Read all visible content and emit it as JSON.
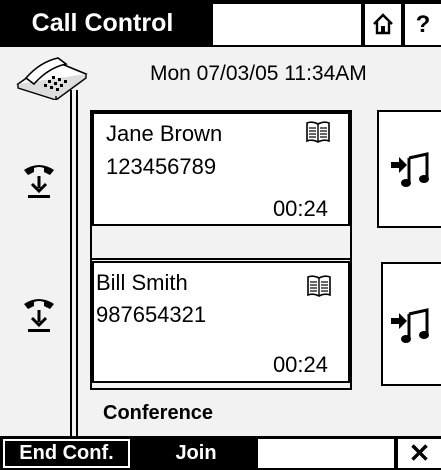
{
  "header": {
    "title": "Call Control",
    "home_icon": "home-icon",
    "help_label": "?"
  },
  "datetime": "Mon 07/03/05 11:34AM",
  "calls": [
    {
      "name": "Jane Brown",
      "number": "123456789",
      "duration": "00:24",
      "icon": "phonebook-icon"
    },
    {
      "name": "Bill Smith",
      "number": "987654321",
      "duration": "00:24",
      "icon": "phonebook-icon"
    }
  ],
  "conference_label": "Conference",
  "softkeys": {
    "end_conf": "End Conf.",
    "join": "Join",
    "close": "✕"
  }
}
